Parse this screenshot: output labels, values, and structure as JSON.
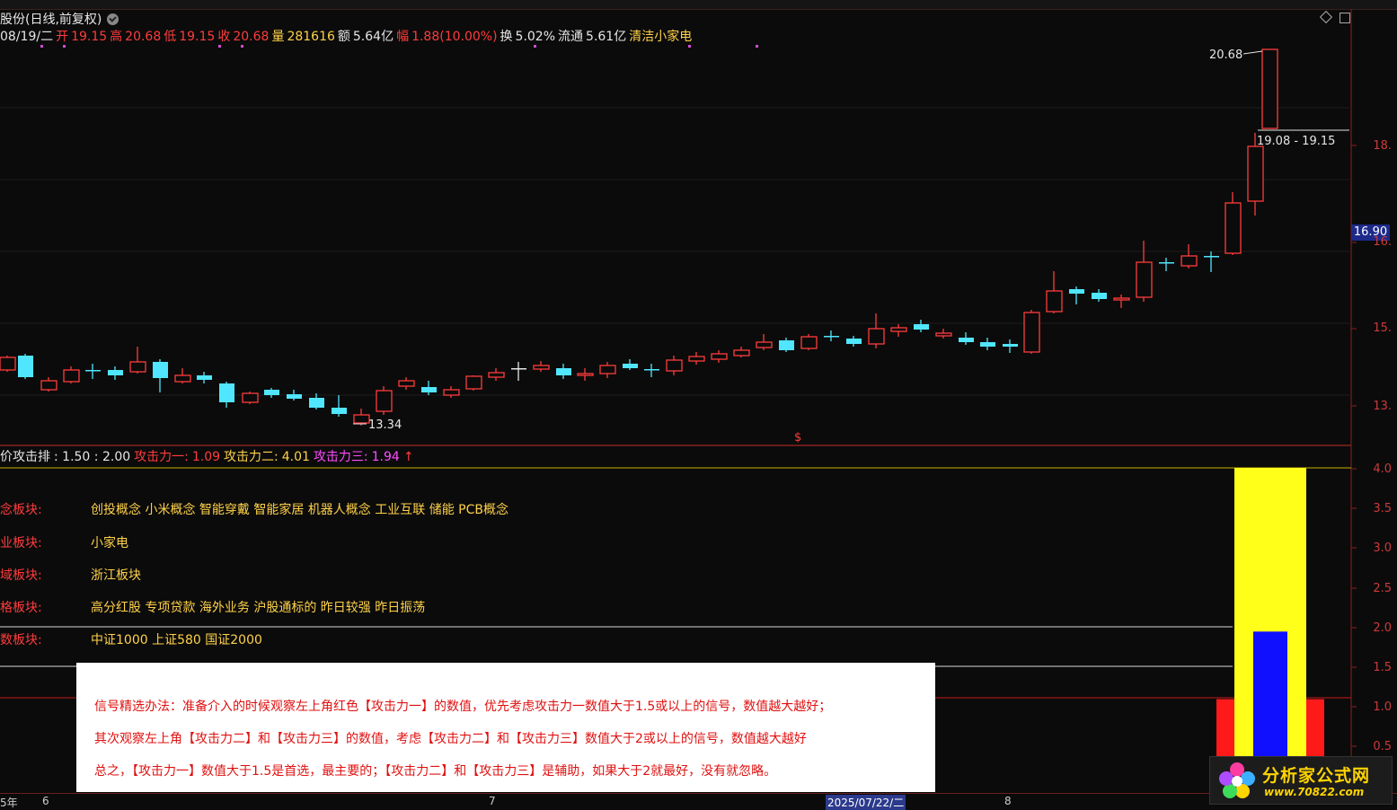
{
  "window": {
    "title": "股份(日线,前复权)"
  },
  "quote": {
    "date": "08/19/二",
    "open_label": "开",
    "open": "19.15",
    "high_label": "高",
    "high": "20.68",
    "low_label": "低",
    "low": "19.15",
    "close_label": "收",
    "close": "20.68",
    "vol_label": "量",
    "vol": "281616",
    "amount_label": "额",
    "amount": "5.64亿",
    "change_label": "幅",
    "change": "1.88(10.00%)",
    "turnover_label": "换",
    "turnover": "5.02%",
    "float_label": "流通",
    "float": "5.61亿",
    "industry": "清洁小家电"
  },
  "main_chart": {
    "high_marker": "20.68",
    "low_marker": "13.34",
    "range_box": "19.08 - 19.15",
    "current_price": "16.90",
    "axis": [
      "18.",
      "16.",
      "15.",
      "13."
    ],
    "signal_char": "$"
  },
  "indicator": {
    "name": "价攻击排",
    "params": ": 1.50 : 2.00",
    "p1_label": "攻击力一:",
    "p1": "1.09",
    "p2_label": "攻击力二:",
    "p2": "4.01",
    "p3_label": "攻击力三:",
    "p3": "1.94",
    "p3_arrow": "↑",
    "axis": [
      "4.0",
      "3.5",
      "3.0",
      "2.5",
      "2.0",
      "1.5",
      "1.0",
      "0.5"
    ],
    "colors": {
      "yellow": "#ffff1a",
      "blue": "#1010ff",
      "red": "#ff1a1a"
    }
  },
  "sectors": [
    {
      "label": "念板块:",
      "value": "创投概念 小米概念 智能穿戴 智能家居 机器人概念 工业互联 储能 PCB概念"
    },
    {
      "label": "业板块:",
      "value": "小家电"
    },
    {
      "label": "域板块:",
      "value": "浙江板块"
    },
    {
      "label": "格板块:",
      "value": "高分红股 专项贷款 海外业务 沪股通标的 昨日较强 昨日振荡"
    },
    {
      "label": "数板块:",
      "value": "中证1000 上证580 国证2000"
    }
  ],
  "note": {
    "line1": "信号精选办法：准备介入的时候观察左上角红色【攻击力一】的数值，优先考虑攻击力一数值大于1.5或以上的信号，数值越大越好；",
    "line2": "其次观察左上角【攻击力二】和【攻击力三】的数值，考虑【攻击力二】和【攻击力三】数值大于2或以上的信号，数值越大越好",
    "line3": "总之，【攻击力一】数值大于1.5是首选，最主要的；【攻击力二】和【攻击力三】是辅助，如果大于2就最好，没有就忽略。"
  },
  "dates": {
    "d0": "5年",
    "d1": "6",
    "d2": "7",
    "d3": "2025/07/22/二",
    "d4": "8"
  },
  "logo": {
    "name": "分析家公式网",
    "url": "www.70822.com"
  }
}
